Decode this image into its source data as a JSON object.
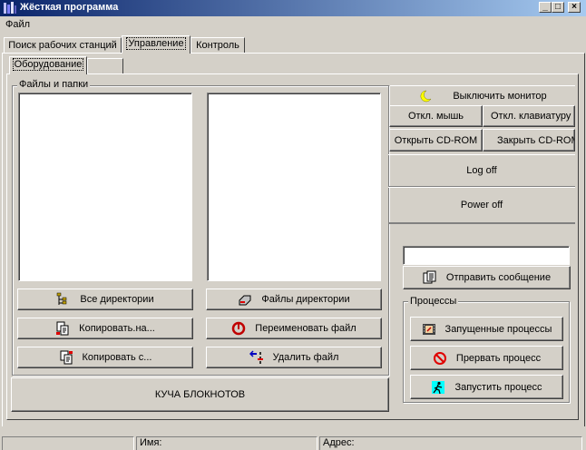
{
  "window": {
    "title": "Жёсткая программа"
  },
  "menu": {
    "file": "Файл"
  },
  "tabs": [
    "Поиск рабочих станций",
    "Управление",
    "Контроль"
  ],
  "subtabs": [
    "Оборудование",
    ""
  ],
  "files_group": {
    "label": "Файлы и папки",
    "buttons": {
      "all_dirs": "Все директории",
      "dir_files": "Файлы директории",
      "copy_to": "Копировать.на...",
      "rename": "Переименовать файл",
      "copy_from": "Копировать с...",
      "delete": "Удалить файл"
    }
  },
  "notepads_button": "КУЧА БЛОКНОТОВ",
  "device_controls": {
    "monitor_off": "Выключить монитор",
    "mouse_off": "Откл. мышь",
    "keyboard_off": "Откл. клавиатуру",
    "cd_open": "Открыть CD-ROM",
    "cd_close": "Закрыть CD-ROM",
    "logoff": "Log off",
    "poweroff": "Power off"
  },
  "message": {
    "input_value": "",
    "send": "Отправить сообщение"
  },
  "processes": {
    "label": "Процессы",
    "running": "Запущенные процессы",
    "kill": "Прервать процесс",
    "start": "Запустить процесс"
  },
  "statusbar": {
    "name_label": "Имя:",
    "address_label": "Адрес:"
  },
  "colors": {
    "titlebar_start": "#0a246a",
    "titlebar_end": "#a6caf0",
    "face": "#d4d0c8"
  }
}
